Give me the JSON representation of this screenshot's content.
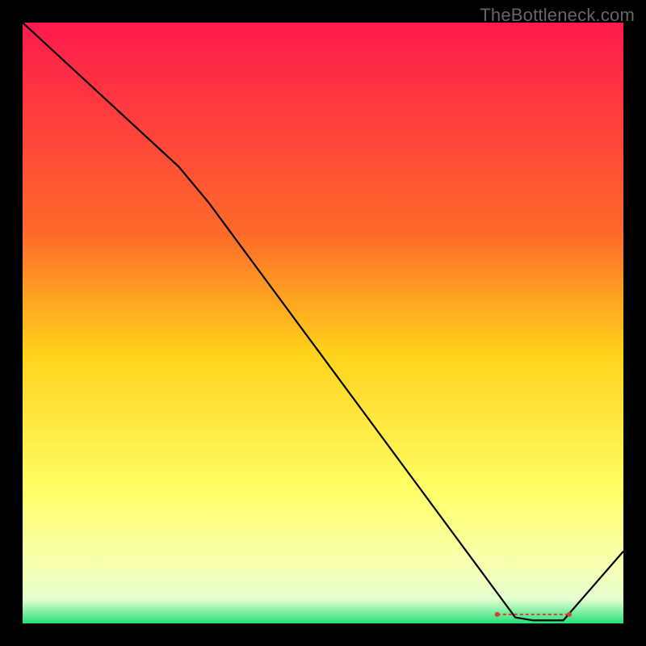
{
  "watermark": "TheBottleneck.com",
  "chart_data": {
    "type": "line",
    "title": "",
    "xlabel": "",
    "ylabel": "",
    "xlim": [
      0,
      100
    ],
    "ylim": [
      0,
      100
    ],
    "background_gradient": {
      "stops": [
        {
          "offset": 0,
          "color": "#ff1a4d"
        },
        {
          "offset": 35,
          "color": "#ff6a2a"
        },
        {
          "offset": 55,
          "color": "#ffd21a"
        },
        {
          "offset": 78,
          "color": "#ffff66"
        },
        {
          "offset": 90,
          "color": "#f8ffb0"
        },
        {
          "offset": 96,
          "color": "#e4ffd0"
        },
        {
          "offset": 100,
          "color": "#26e07a"
        }
      ]
    },
    "series": [
      {
        "name": "bottleneck-curve",
        "color": "#000000",
        "points": [
          {
            "x": 0,
            "y": 100
          },
          {
            "x": 26,
            "y": 76
          },
          {
            "x": 31,
            "y": 70
          },
          {
            "x": 82,
            "y": 1
          },
          {
            "x": 85,
            "y": 0.5
          },
          {
            "x": 90,
            "y": 0.5
          },
          {
            "x": 100,
            "y": 12
          }
        ]
      }
    ],
    "annotation": {
      "text": "",
      "x": 85,
      "y": 1.5
    }
  },
  "colors": {
    "curve": "#000000",
    "marker": "#d04030"
  }
}
